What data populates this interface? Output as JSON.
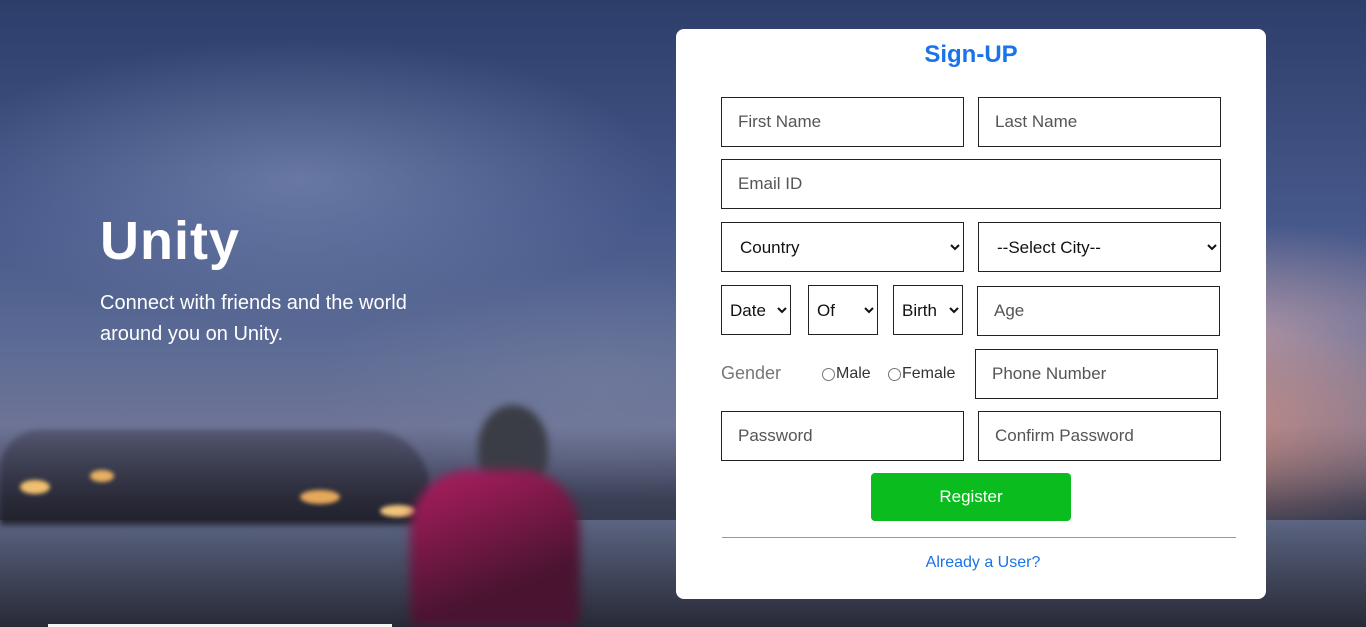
{
  "hero": {
    "title": "Unity",
    "subtitle": "Connect with friends and the world around you on Unity."
  },
  "form": {
    "title": "Sign-UP",
    "first_name_placeholder": "First Name",
    "last_name_placeholder": "Last Name",
    "email_placeholder": "Email ID",
    "country_selected": "Country",
    "city_selected": "--Select City--",
    "dob_date_selected": "Date",
    "dob_of_selected": "Of",
    "dob_birth_selected": "Birth",
    "age_placeholder": "Age",
    "gender_label": "Gender",
    "gender_male": "Male",
    "gender_female": "Female",
    "phone_placeholder": "Phone Number",
    "password_placeholder": "Password",
    "confirm_password_placeholder": "Confirm Password",
    "register_label": "Register",
    "already_user_link": "Already a User?"
  },
  "colors": {
    "accent_blue": "#1a73e8",
    "register_green": "#0abc1e"
  }
}
